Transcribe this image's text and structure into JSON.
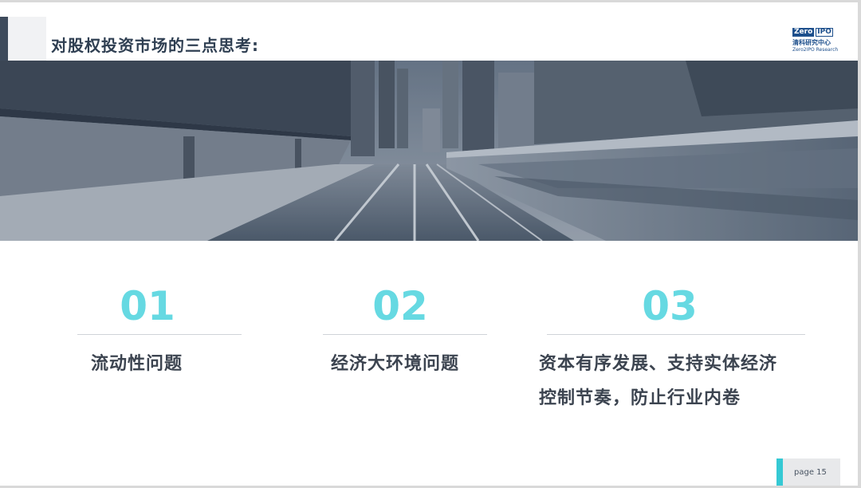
{
  "header": {
    "title": "对股权投资市场的三点思考:"
  },
  "logo": {
    "word_left": "Zero",
    "word_right": "IPO",
    "chinese": "清科研究中心",
    "english": "Zero2IPO Research"
  },
  "banner": {
    "image": "grayscale photo of elevated train tracks with motion-blurred train and platform"
  },
  "points": [
    {
      "number": "01",
      "label_lines": [
        "流动性问题"
      ]
    },
    {
      "number": "02",
      "label_lines": [
        "经济大环境问题"
      ]
    },
    {
      "number": "03",
      "label_lines": [
        "资本有序发展、支持实体经济",
        "控制节奏，防止行业内卷"
      ]
    }
  ],
  "footer": {
    "page_label": "page  15"
  },
  "colors": {
    "accent_cyan": "#66d9e2",
    "dark_slate": "#3e4b5c",
    "text_dark": "#3c4450"
  }
}
